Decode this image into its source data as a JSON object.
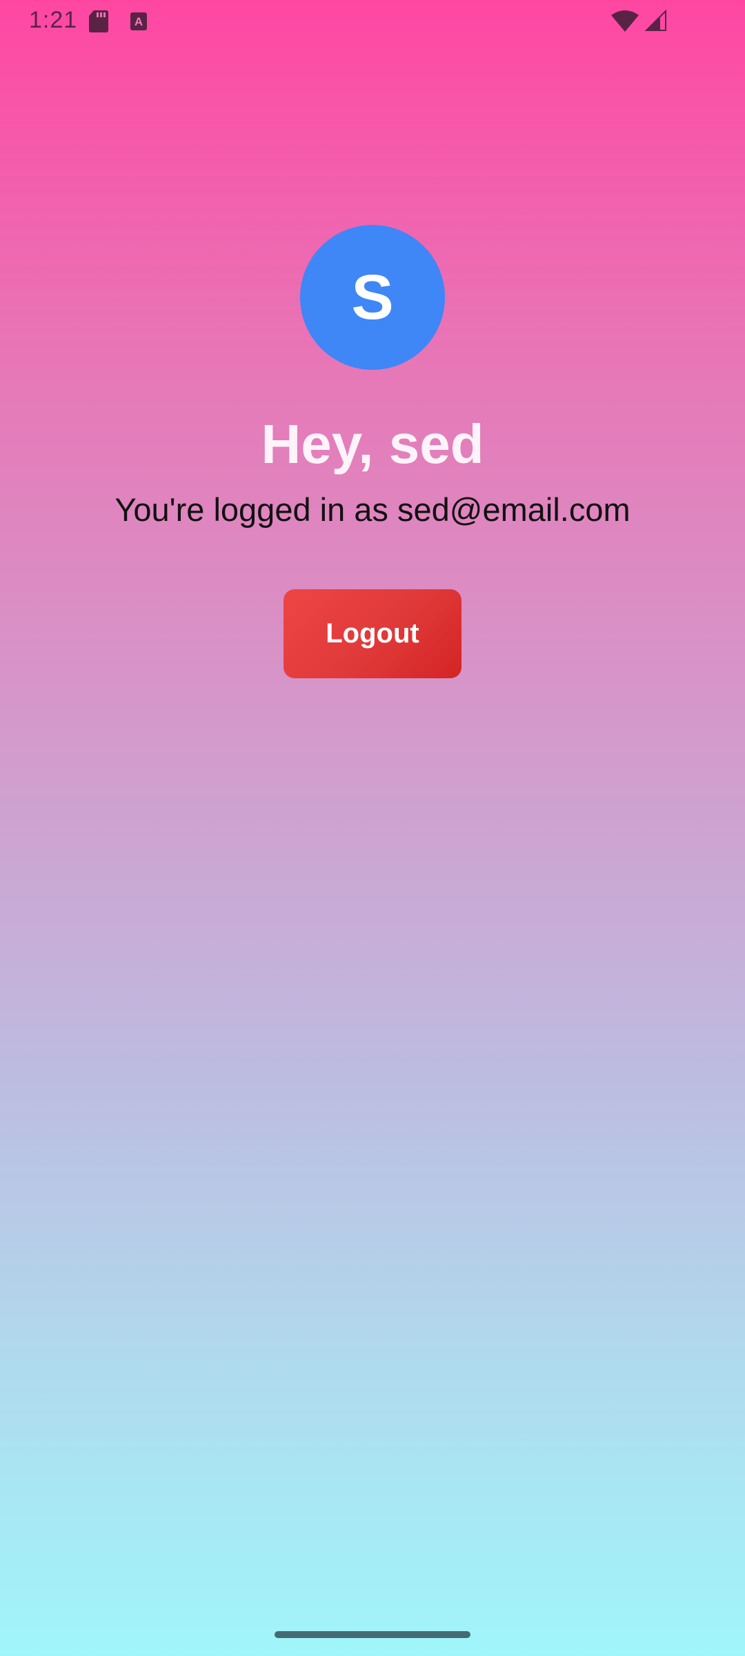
{
  "status_bar": {
    "time": "1:21",
    "left_icons": [
      "sd-card-icon",
      "font-icon"
    ],
    "right_icons": [
      "wifi-icon",
      "signal-icon"
    ],
    "font_icon_letter": "A"
  },
  "profile": {
    "avatar_initial": "S",
    "greeting": "Hey, sed",
    "logged_in_text": "You're logged in as sed@email.com"
  },
  "actions": {
    "logout_label": "Logout"
  },
  "colors": {
    "gradient_top": "#ff47a2",
    "gradient_bottom": "#a0f6fa",
    "avatar": "#3f86f7",
    "logout_button": "#e03939"
  }
}
